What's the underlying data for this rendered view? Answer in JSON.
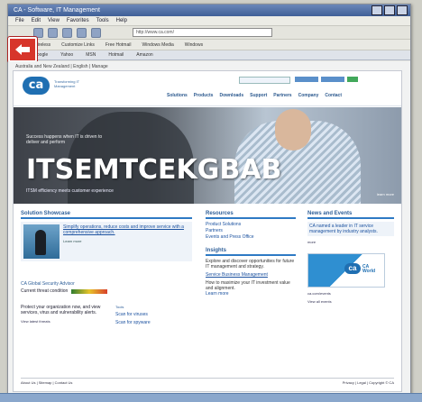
{
  "browser": {
    "title": "CA - Software, IT Management",
    "menu": [
      "File",
      "Edit",
      "View",
      "Favorites",
      "Tools",
      "Help"
    ],
    "address": "http://www.ca.com/",
    "links": [
      "Wireless",
      "Customize Links",
      "Free Hotmail",
      "Windows Media",
      "Windows"
    ],
    "favorites": [
      "Google",
      "Yahoo",
      "MSN",
      "Hotmail",
      "Amazon"
    ]
  },
  "page": {
    "breadcrumb": "Australia and New Zealand | English | Manage",
    "logo": "ca",
    "tagline": "Transforming IT Management",
    "nav": [
      "Solutions",
      "Products",
      "Downloads",
      "Support",
      "Partners",
      "Company",
      "Contact"
    ],
    "hero": {
      "small_text": "Success happens when IT is driven to deliver and perform",
      "headline": "ITSEMTCEKGBAB",
      "subline": "ITSM efficiency meets customer experience",
      "more": "learn more"
    },
    "col1": {
      "title": "Solution Showcase",
      "feature_text": "Simplify operations, reduce costs and improve service with a comprehensive approach.",
      "feature_link": "Learn more",
      "alert_title": "CA Global Security Advisor",
      "alert_label": "Current threat condition",
      "protect_text": "Protect your organization now, and view services, virus and vulnerability alerts.",
      "tools_label": "Tools",
      "tool1": "Scan for viruses",
      "tool2": "Scan for spyware",
      "view_alerts": "View latest threats"
    },
    "col2": {
      "title": "Resources",
      "links": [
        "Product Solutions",
        "Partners",
        "Events and Press Office"
      ],
      "title2": "Insights",
      "desc": "Explore and discover opportunities for future IT management and strategy.",
      "article_title": "Service Business Management",
      "article_desc": "How to maximize your IT investment value and alignment.",
      "learn_more": "Learn more"
    },
    "col3": {
      "title": "News and Events",
      "news_text": "CA named a leader in IT service management by industry analysts.",
      "more": "more",
      "promo_logo": "ca",
      "promo_text": "CA World",
      "promo_link": "ca.com/events",
      "view_all": "View all events"
    },
    "footer": {
      "left": "About Us | Sitemap | Contact Us",
      "right": "Privacy | Legal | Copyright © CA"
    }
  }
}
